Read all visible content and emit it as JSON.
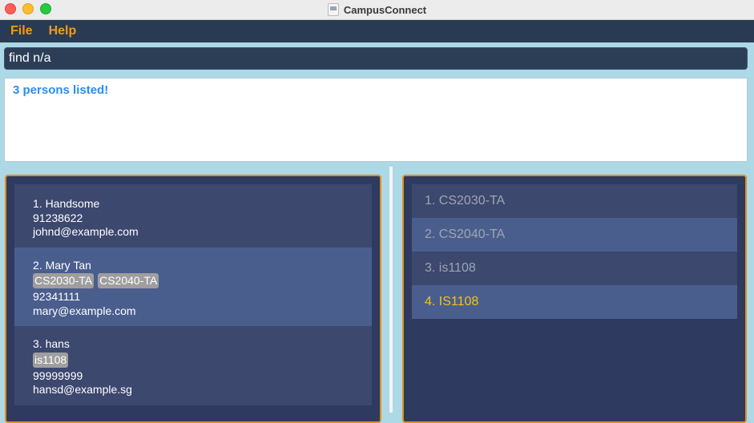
{
  "window": {
    "title": "CampusConnect"
  },
  "menu": {
    "file": "File",
    "help": "Help"
  },
  "command": {
    "value": "find n/a"
  },
  "result": {
    "message": "3 persons listed!"
  },
  "persons": [
    {
      "index_name": "1. Handsome",
      "tags": [],
      "phone": "91238622",
      "email": "johnd@example.com"
    },
    {
      "index_name": "2. Mary Tan",
      "tags": [
        "CS2030-TA",
        "CS2040-TA"
      ],
      "phone": "92341111",
      "email": "mary@example.com"
    },
    {
      "index_name": "3. hans",
      "tags": [
        "is1108"
      ],
      "phone": "99999999",
      "email": "hansd@example.sg"
    }
  ],
  "tag_list": [
    {
      "label": "1. CS2030-TA"
    },
    {
      "label": "2. CS2040-TA"
    },
    {
      "label": "3. is1108"
    },
    {
      "label": "4. IS1108"
    }
  ],
  "colors": {
    "accent": "#f39c12",
    "selected_tag": "#f1c40f",
    "result_text": "#2a8ef0"
  }
}
